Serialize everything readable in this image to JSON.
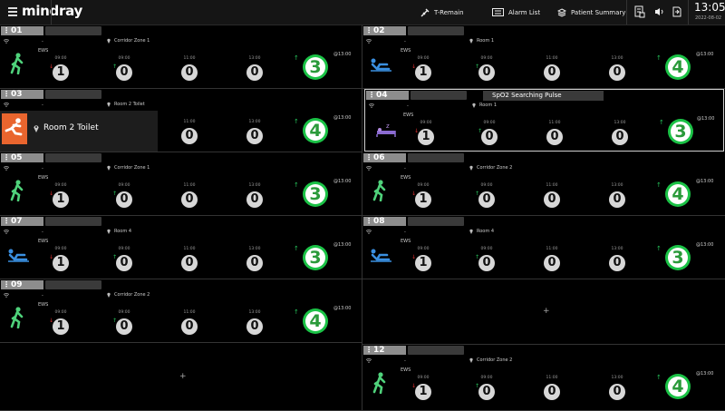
{
  "topbar": {
    "brand": "mindray",
    "t_remain_label": "T-Remain",
    "alarm_list_label": "Alarm List",
    "patient_summary_label": "Patient Summary",
    "time": "13:05",
    "date": "2022-08-02"
  },
  "times": [
    "09:00",
    "09:00",
    "11:00",
    "13:00"
  ],
  "ews_label": "EWS",
  "at_label": "@13:00",
  "patients": [
    {
      "bed": "01",
      "location": "Corridor Zone 1",
      "dash": "-",
      "values": [
        "1",
        "0",
        "0",
        "0"
      ],
      "score": "3",
      "icon": "walking-person-icon",
      "color_icon": "#4fd27b"
    },
    {
      "bed": "02",
      "location": "Room 1",
      "dash": "-",
      "values": [
        "1",
        "0",
        "0",
        "0"
      ],
      "score": "4",
      "icon": "reclining-patient-icon",
      "color_icon": "#3a8fe0"
    },
    {
      "bed": "03",
      "location": "Room 2 Toilet",
      "dash": "-",
      "values": [
        "",
        "",
        "0",
        "0"
      ],
      "score": "4",
      "icon": "",
      "alarm": "Room 2 Toilet",
      "alarm_icon": "fall-alarm-icon"
    },
    {
      "bed": "04",
      "location": "Room 1",
      "dash": "-",
      "values": [
        "1",
        "0",
        "0",
        "0"
      ],
      "score": "3",
      "icon": "sleeping-patient-icon",
      "status": "SpO2 Searching Pulse"
    },
    {
      "bed": "05",
      "location": "Corridor Zone 1",
      "dash": "-",
      "values": [
        "1",
        "0",
        "0",
        "0"
      ],
      "score": "3",
      "icon": "walking-person-icon"
    },
    {
      "bed": "06",
      "location": "Corridor Zone 2",
      "dash": "-",
      "values": [
        "1",
        "0",
        "0",
        "0"
      ],
      "score": "4",
      "icon": "walking-person-icon"
    },
    {
      "bed": "07",
      "location": "Room 4",
      "dash": "-",
      "values": [
        "1",
        "0",
        "0",
        "0"
      ],
      "score": "3",
      "icon": "reclining-patient-icon"
    },
    {
      "bed": "08",
      "location": "Room 4",
      "dash": "-",
      "values": [
        "1",
        "0",
        "0",
        "0"
      ],
      "score": "3",
      "icon": "reclining-patient-icon"
    },
    {
      "bed": "09",
      "location": "Corridor Zone 2",
      "dash": "-",
      "values": [
        "1",
        "0",
        "0",
        "0"
      ],
      "score": "4",
      "icon": "walking-person-icon"
    },
    {
      "bed": "12",
      "location": "Corridor Zone 2",
      "dash": "-",
      "values": [
        "1",
        "0",
        "0",
        "0"
      ],
      "score": "4",
      "icon": "walking-person-icon"
    }
  ],
  "add_label": "+",
  "colors": {
    "score_green": "#1bc246",
    "alarm_orange": "#e9652e",
    "selected_border": "#cfcfcf"
  }
}
